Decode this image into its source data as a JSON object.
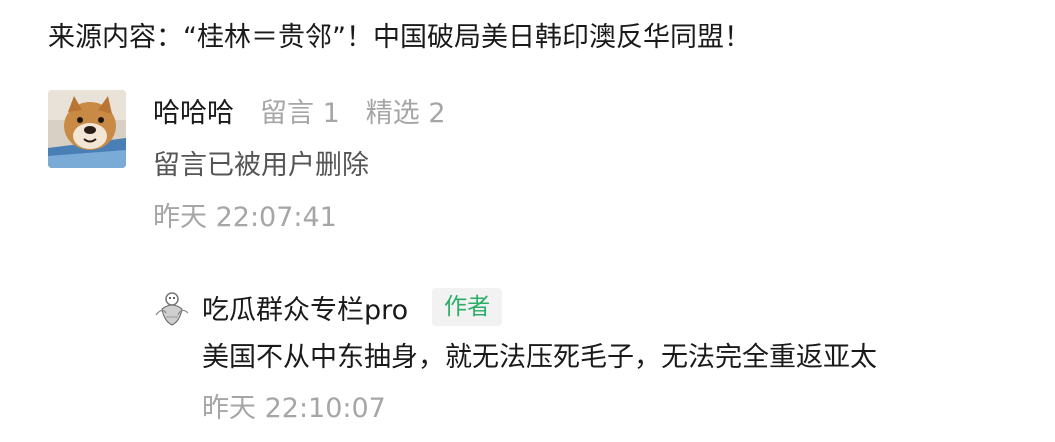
{
  "source": {
    "text": "来源内容：“桂林＝贵邻”！中国破局美日韩印澳反华同盟！"
  },
  "comment": {
    "username": "哈哈哈",
    "comment_count": "留言 1",
    "featured_count": "精选 2",
    "body": "留言已被用户删除",
    "time": "昨天 22:07:41",
    "avatar_icon": "shiba-dog-avatar"
  },
  "reply": {
    "username": "吃瓜群众专栏pro",
    "badge": "作者",
    "body": "美国不从中东抽身，就无法压死毛子，无法完全重返亚太",
    "time": "昨天 22:10:07",
    "avatar_icon": "ink-drawing-avatar",
    "badge_color": "#2aae67"
  }
}
